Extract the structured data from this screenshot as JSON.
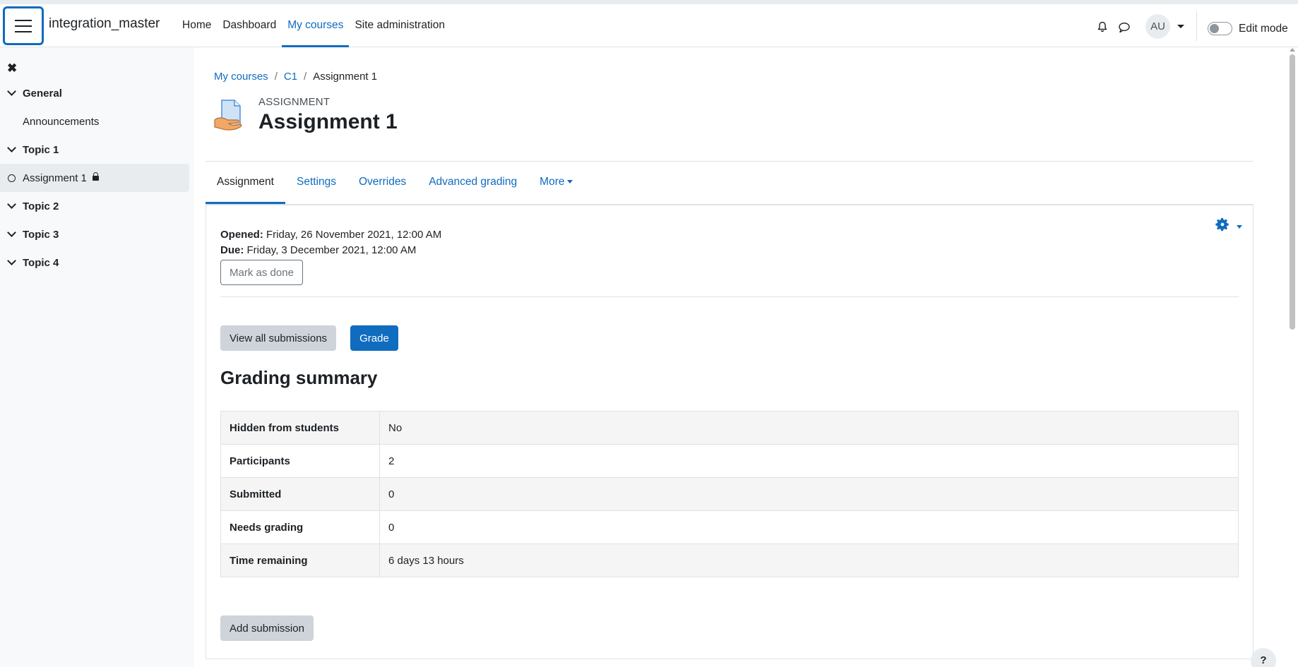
{
  "navbar": {
    "site_name": "integration_master",
    "links": [
      "Home",
      "Dashboard",
      "My courses",
      "Site administration"
    ],
    "active_link": "My courses",
    "avatar_initials": "AU",
    "edit_mode_label": "Edit mode"
  },
  "drawer": {
    "close_glyph": "✖",
    "items": [
      {
        "label": "General",
        "kind": "section"
      },
      {
        "label": "Announcements",
        "kind": "activity"
      },
      {
        "label": "Topic 1",
        "kind": "section"
      },
      {
        "label": "Assignment 1",
        "kind": "activity",
        "active": true
      },
      {
        "label": "Topic 2",
        "kind": "section"
      },
      {
        "label": "Topic 3",
        "kind": "section"
      },
      {
        "label": "Topic 4",
        "kind": "section"
      }
    ]
  },
  "breadcrumb": {
    "items": [
      "My courses",
      "C1"
    ],
    "current": "Assignment 1",
    "separator": "/"
  },
  "header": {
    "module_type": "ASSIGNMENT",
    "title": "Assignment 1"
  },
  "tabs": {
    "items": [
      "Assignment",
      "Settings",
      "Overrides",
      "Advanced grading",
      "More"
    ],
    "active": "Assignment"
  },
  "dates": {
    "opened_label": "Opened:",
    "opened_value": "Friday, 26 November 2021, 12:00 AM",
    "due_label": "Due:",
    "due_value": "Friday, 3 December 2021, 12:00 AM"
  },
  "buttons": {
    "mark_done": "Mark as done",
    "view_all": "View all submissions",
    "grade": "Grade",
    "add_submission": "Add submission"
  },
  "summary": {
    "heading": "Grading summary",
    "rows": [
      {
        "label": "Hidden from students",
        "value": "No"
      },
      {
        "label": "Participants",
        "value": "2"
      },
      {
        "label": "Submitted",
        "value": "0"
      },
      {
        "label": "Needs grading",
        "value": "0"
      },
      {
        "label": "Time remaining",
        "value": "6 days 13 hours"
      }
    ]
  },
  "help_glyph": "?",
  "colors": {
    "primary": "#0f6cbf",
    "secondary_button": "#ced4da",
    "drawer_bg": "#f8f9fa"
  }
}
